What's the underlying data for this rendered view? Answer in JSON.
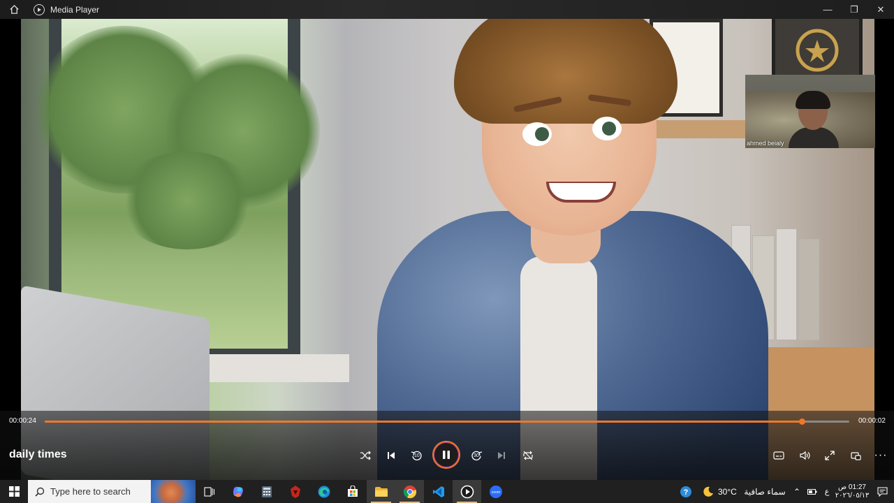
{
  "window": {
    "title": "Media Player",
    "home_icon": "home-icon",
    "app_icon": "media-player-icon"
  },
  "video": {
    "webcam_name": "ahmed beialy"
  },
  "player": {
    "elapsed": "00:00:24",
    "remaining": "00:00:02",
    "progress_fraction": 0.941,
    "media_title": "daily times",
    "skip_back_seconds": "10",
    "skip_forward_seconds": "30",
    "accent_color": "#f0782a",
    "state": "playing"
  },
  "taskbar": {
    "search_placeholder": "Type here to search",
    "apps": [
      "task-view",
      "copilot",
      "calculator",
      "game",
      "edge",
      "store",
      "file-explorer",
      "chrome",
      "vscode",
      "media-player",
      "zoom"
    ],
    "active_app": "media-player",
    "weather_temp": "30°C",
    "weather_text": "سماء صافية",
    "lang": "ع",
    "time": "01:27 ص",
    "date": "٢٠٢٦/٠٥/١٣"
  }
}
